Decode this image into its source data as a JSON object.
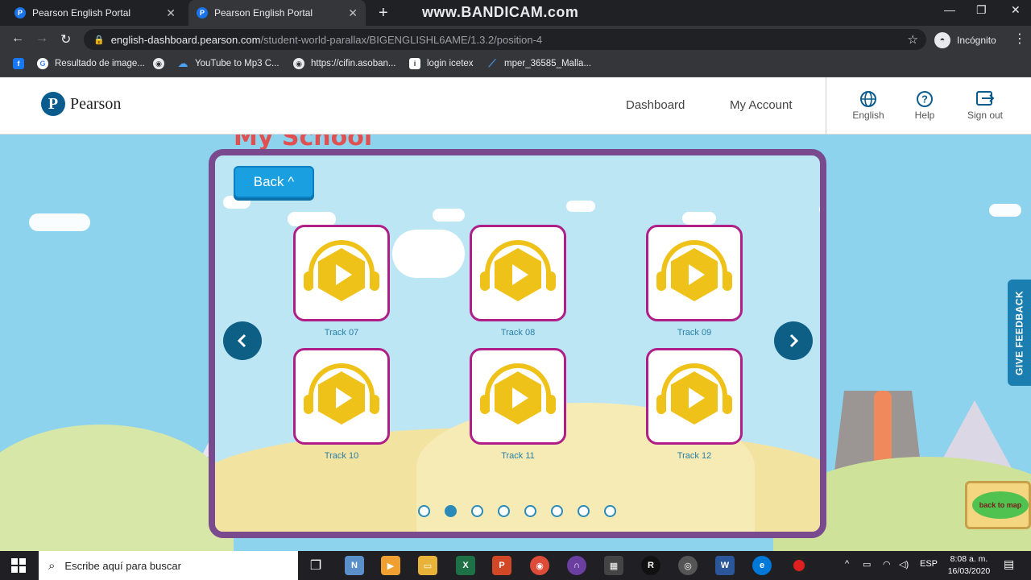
{
  "browser": {
    "tabs": [
      {
        "title": "Pearson English Portal",
        "favicon": "P"
      },
      {
        "title": "Pearson English Portal",
        "favicon": "P"
      }
    ],
    "watermark": "www.BANDICAM.com",
    "url_host": "english-dashboard.pearson.com",
    "url_path": "/student-world-parallax/BIGENGLISHL6AME/1.3.2/position-4",
    "profile_label": "Incógnito",
    "bookmarks": [
      {
        "label": "",
        "icon": "facebook-icon",
        "glyph": "f",
        "color": "#1877f2"
      },
      {
        "label": "Resultado de image...",
        "icon": "google-icon",
        "glyph": "G",
        "color": "#4285f4"
      },
      {
        "label": "",
        "icon": "globe-icon",
        "glyph": "◉",
        "color": "#5f6368"
      },
      {
        "label": "YouTube to Mp3 C...",
        "icon": "cloud-icon",
        "glyph": "☁",
        "color": "#1a73e8"
      },
      {
        "label": "https://cifin.asoban...",
        "icon": "globe-icon",
        "glyph": "◉",
        "color": "#5f6368"
      },
      {
        "label": "login icetex",
        "icon": "icetex-icon",
        "glyph": "i",
        "color": "#444"
      },
      {
        "label": "mper_36585_Malla...",
        "icon": "chart-icon",
        "glyph": "⟋",
        "color": "#4a90e2"
      }
    ]
  },
  "site": {
    "brand": "Pearson",
    "brand_mark": "P",
    "nav": [
      "Dashboard",
      "My Account"
    ],
    "actions": [
      {
        "label": "English",
        "icon": "globe-icon",
        "glyph": "🌐"
      },
      {
        "label": "Help",
        "icon": "help-icon",
        "glyph": "?"
      },
      {
        "label": "Sign out",
        "icon": "sign-out-icon",
        "glyph": "⇥"
      }
    ]
  },
  "game": {
    "section_title": "My School",
    "back_label": "Back ^",
    "tracks": [
      "Track 07",
      "Track 08",
      "Track 09",
      "Track 10",
      "Track 11",
      "Track 12"
    ],
    "pages": 8,
    "active_page": 2,
    "feedback_label": "GIVE FEEDBACK",
    "back_to_map_label": "back to map"
  },
  "taskbar": {
    "search_placeholder": "Escribe aquí para buscar",
    "language": "ESP",
    "time": "8:08 a. m.",
    "date": "16/03/2020"
  }
}
